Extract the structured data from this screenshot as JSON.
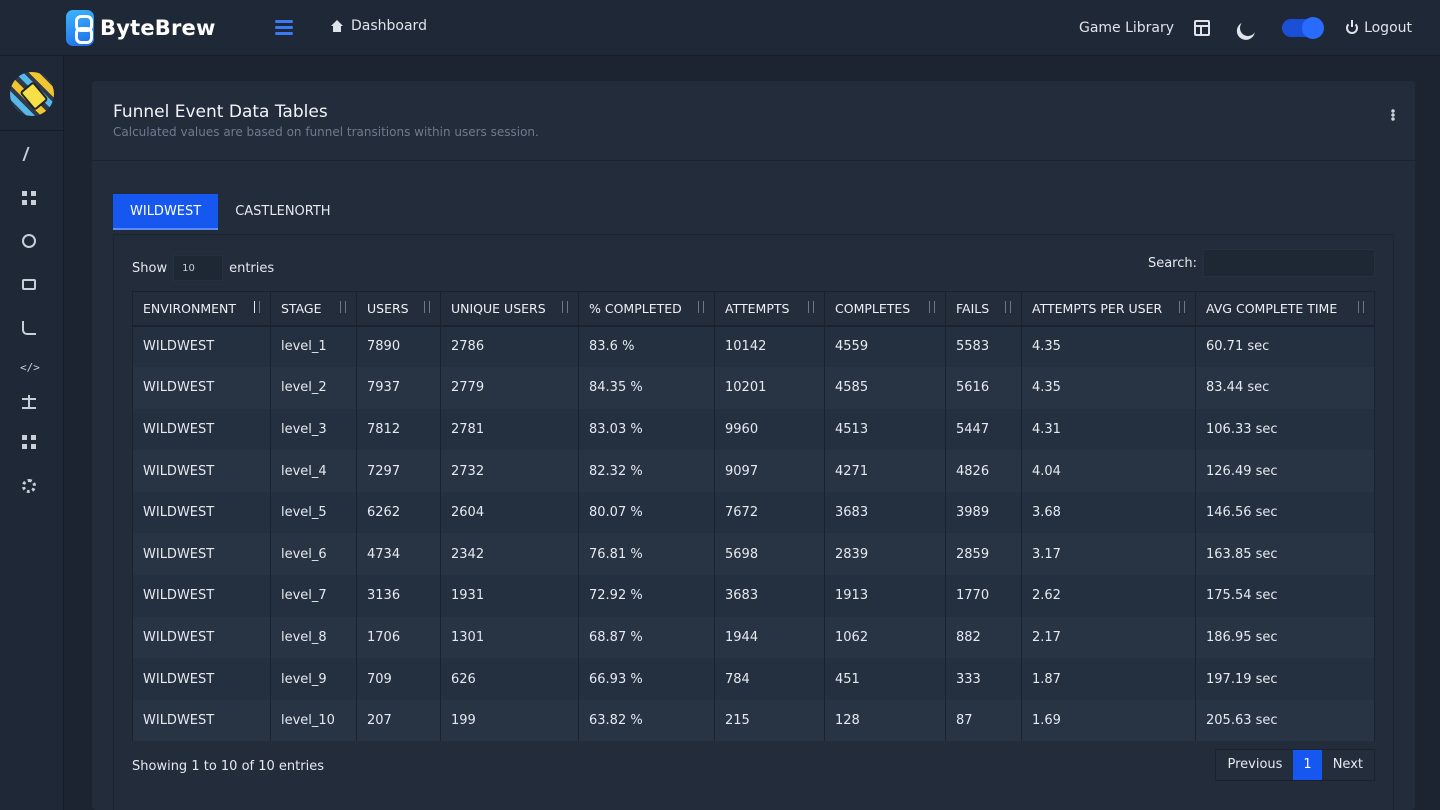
{
  "brand": {
    "name": "ByteBrew"
  },
  "topbar": {
    "breadcrumb": "Dashboard",
    "game_library": "Game Library",
    "logout": "Logout"
  },
  "sidebar": {
    "icons": [
      "bolt-icon",
      "grid-icon",
      "clock-icon",
      "folder-icon",
      "branch-icon",
      "code-icon",
      "scale-icon",
      "apps-icon",
      "gear-icon"
    ]
  },
  "card": {
    "title": "Funnel Event Data Tables",
    "subtitle": "Calculated values are based on funnel transitions within users session."
  },
  "tabs": [
    {
      "label": "WILDWEST",
      "active": true
    },
    {
      "label": "CASTLENORTH",
      "active": false
    }
  ],
  "controls": {
    "show_label": "Show",
    "length_value": "10",
    "entries_label": "entries",
    "search_label": "Search:",
    "search_value": ""
  },
  "table": {
    "columns": [
      "ENVIRONMENT",
      "STAGE",
      "USERS",
      "UNIQUE USERS",
      "% COMPLETED",
      "ATTEMPTS",
      "COMPLETES",
      "FAILS",
      "ATTEMPTS PER USER",
      "AVG COMPLETE TIME"
    ],
    "rows": [
      [
        "WILDWEST",
        "level_1",
        "7890",
        "2786",
        "83.6 %",
        "10142",
        "4559",
        "5583",
        "4.35",
        "60.71 sec"
      ],
      [
        "WILDWEST",
        "level_2",
        "7937",
        "2779",
        "84.35 %",
        "10201",
        "4585",
        "5616",
        "4.35",
        "83.44 sec"
      ],
      [
        "WILDWEST",
        "level_3",
        "7812",
        "2781",
        "83.03 %",
        "9960",
        "4513",
        "5447",
        "4.31",
        "106.33 sec"
      ],
      [
        "WILDWEST",
        "level_4",
        "7297",
        "2732",
        "82.32 %",
        "9097",
        "4271",
        "4826",
        "4.04",
        "126.49 sec"
      ],
      [
        "WILDWEST",
        "level_5",
        "6262",
        "2604",
        "80.07 %",
        "7672",
        "3683",
        "3989",
        "3.68",
        "146.56 sec"
      ],
      [
        "WILDWEST",
        "level_6",
        "4734",
        "2342",
        "76.81 %",
        "5698",
        "2839",
        "2859",
        "3.17",
        "163.85 sec"
      ],
      [
        "WILDWEST",
        "level_7",
        "3136",
        "1931",
        "72.92 %",
        "3683",
        "1913",
        "1770",
        "2.62",
        "175.54 sec"
      ],
      [
        "WILDWEST",
        "level_8",
        "1706",
        "1301",
        "68.87 %",
        "1944",
        "1062",
        "882",
        "2.17",
        "186.95 sec"
      ],
      [
        "WILDWEST",
        "level_9",
        "709",
        "626",
        "66.93 %",
        "784",
        "451",
        "333",
        "1.87",
        "197.19 sec"
      ],
      [
        "WILDWEST",
        "level_10",
        "207",
        "199",
        "63.82 %",
        "215",
        "128",
        "87",
        "1.69",
        "205.63 sec"
      ]
    ]
  },
  "footer": {
    "info": "Showing 1 to 10 of 10 entries",
    "previous": "Previous",
    "current_page": "1",
    "next": "Next"
  },
  "colors": {
    "accent": "#1657f0",
    "background": "#1c2432",
    "card": "#222c3b"
  }
}
